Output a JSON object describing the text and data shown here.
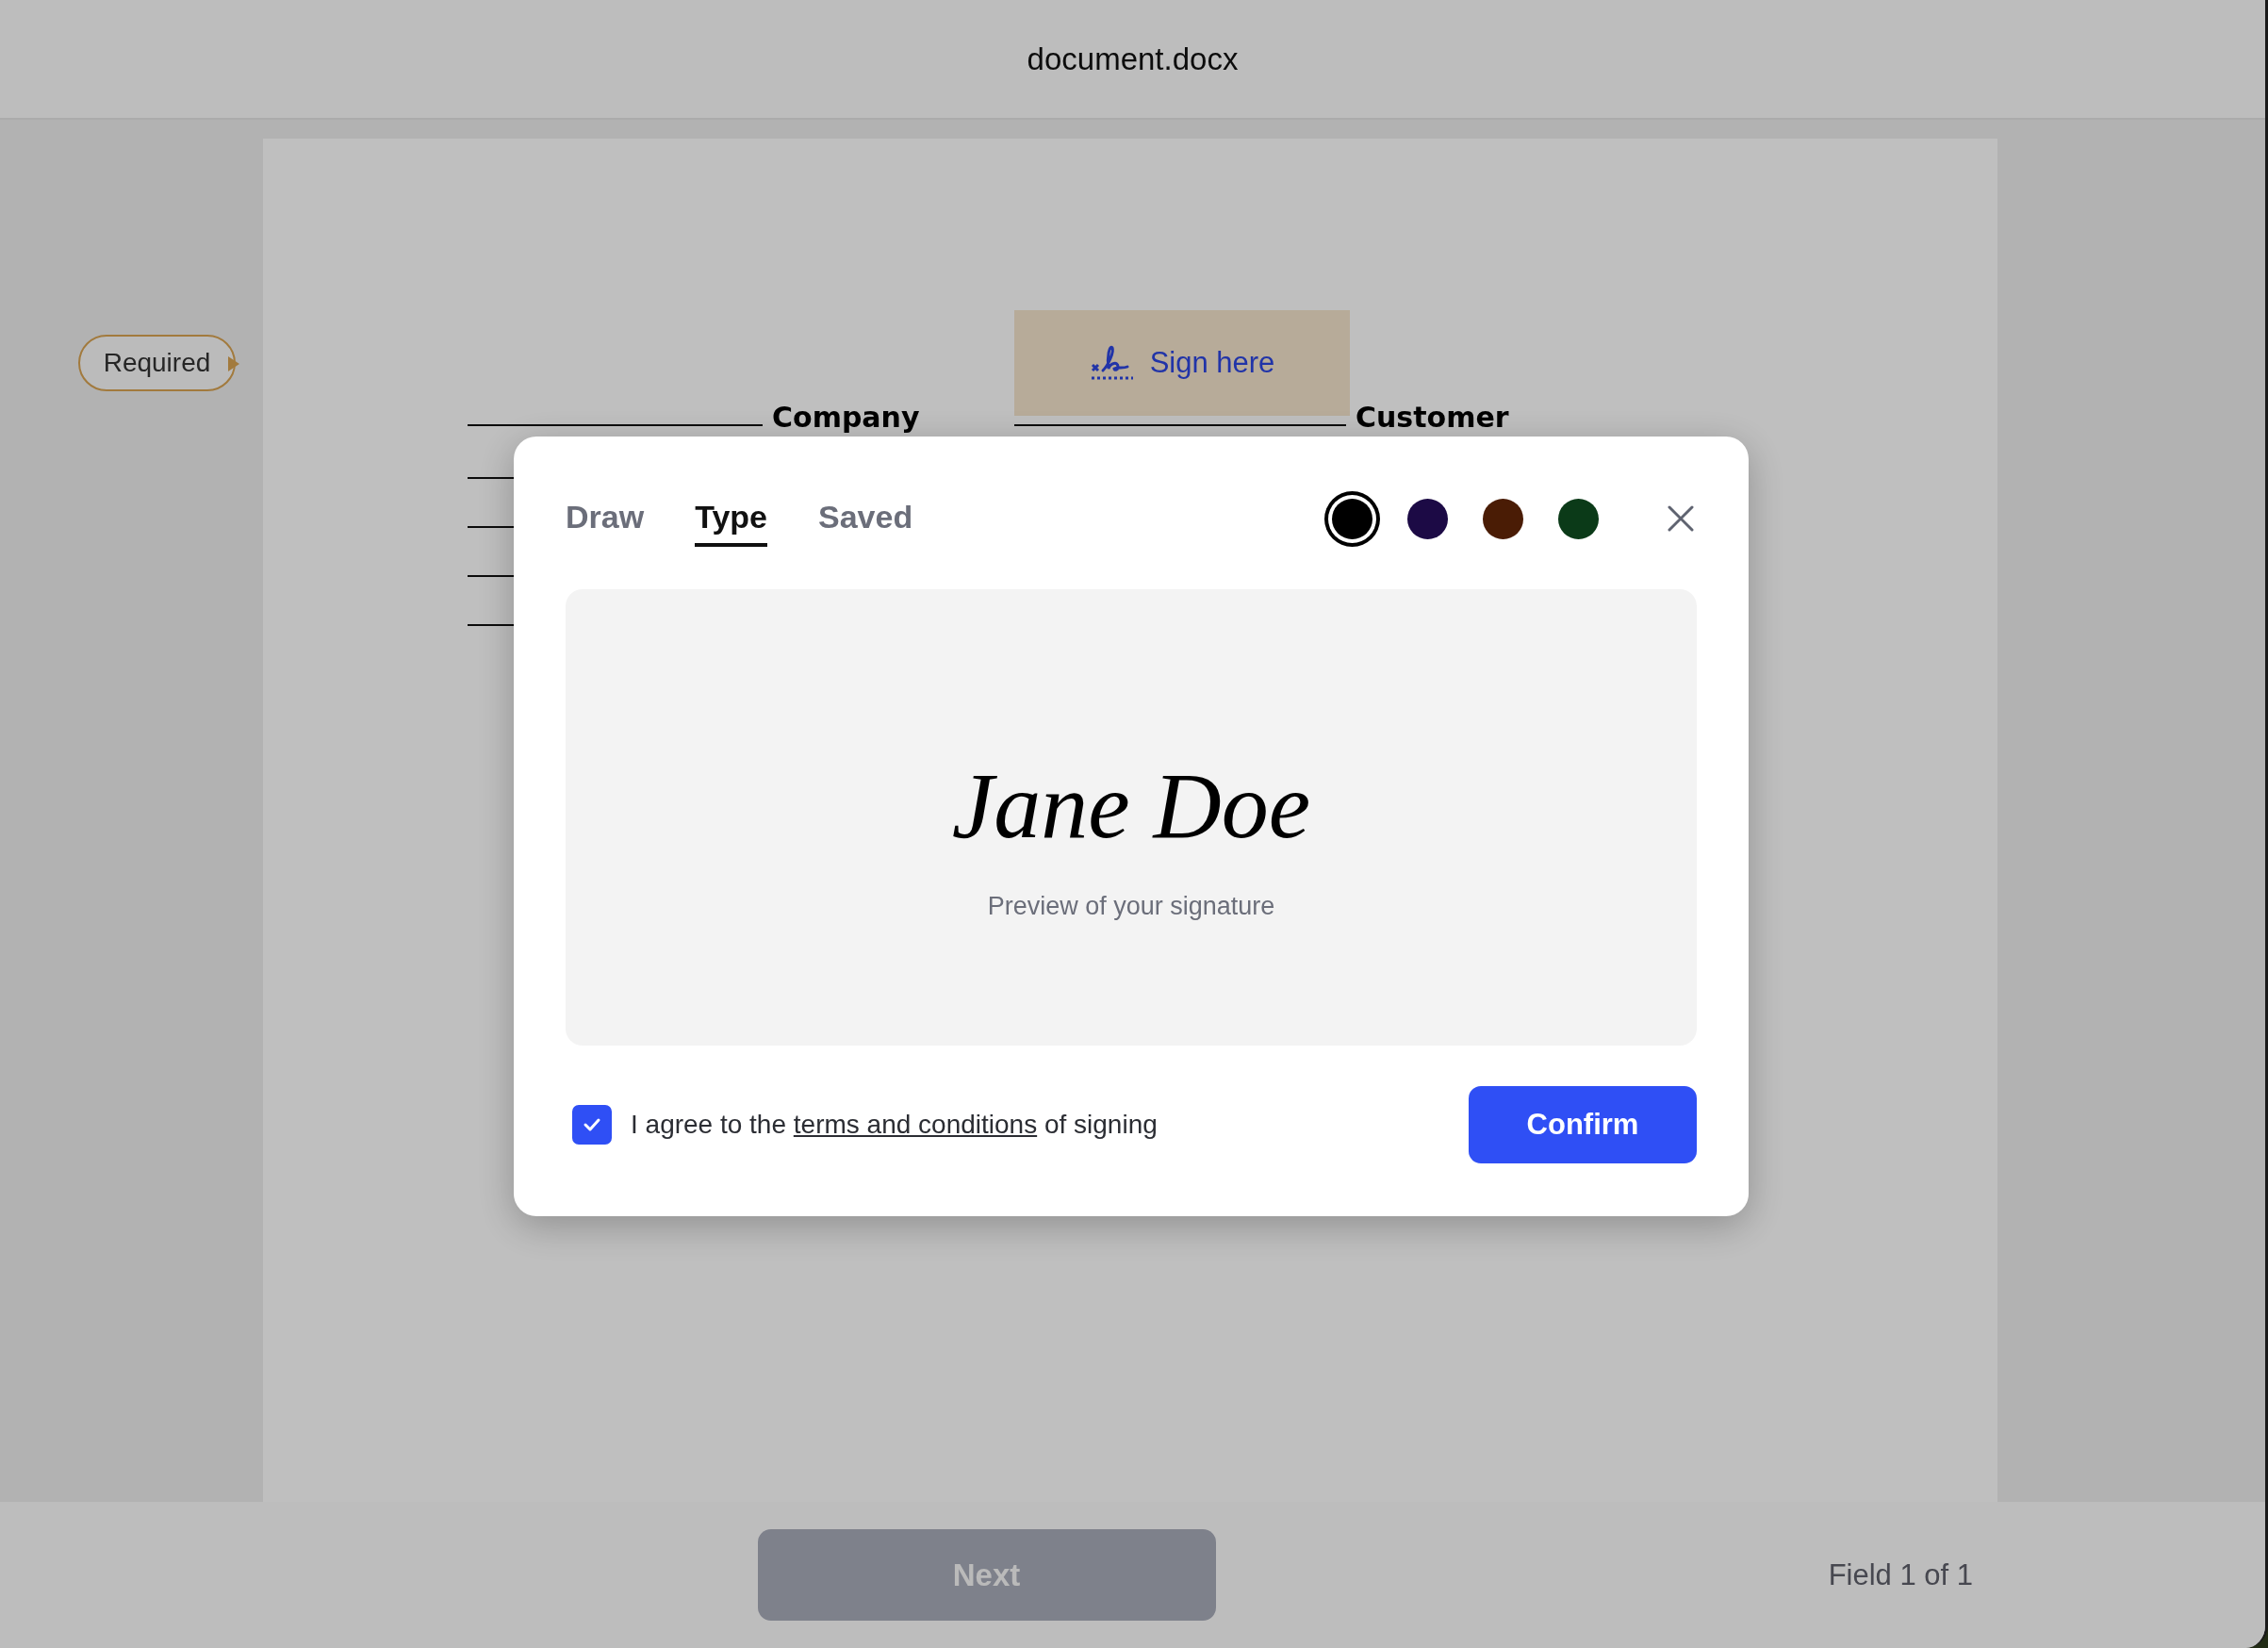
{
  "window": {
    "title": "document.docx"
  },
  "document": {
    "required_badge": "Required",
    "sign_field": {
      "label": "Sign here"
    },
    "signature_lines": [
      {
        "label": "Company"
      },
      {
        "label": "Customer"
      }
    ]
  },
  "dialog": {
    "tabs": [
      {
        "label": "Draw",
        "selected": false
      },
      {
        "label": "Type",
        "selected": true
      },
      {
        "label": "Saved",
        "selected": false
      }
    ],
    "colors": [
      {
        "color": "#000000",
        "selected": true
      },
      {
        "color": "#1c0a45",
        "selected": false
      },
      {
        "color": "#4a1c05",
        "selected": false
      },
      {
        "color": "#0b3a18",
        "selected": false
      }
    ],
    "signature": "Jane Doe",
    "preview_caption": "Preview of your signature",
    "agreement": {
      "checked": true,
      "text_before": "I agree to the",
      "link": "terms and conditions",
      "text_after": "of signing"
    },
    "confirm_button": "Confirm"
  },
  "footer": {
    "next_button": {
      "label": "Next",
      "disabled": true
    },
    "progress": "Field 1 of 1"
  }
}
